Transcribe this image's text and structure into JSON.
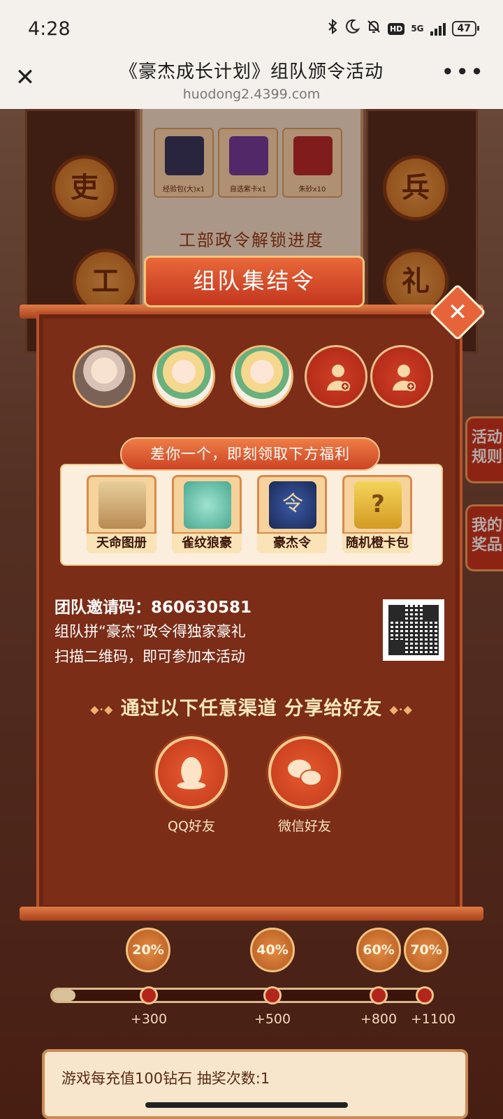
{
  "status_bar": {
    "time": "4:28",
    "network": "5G",
    "hd": "HD",
    "battery": "47"
  },
  "browser": {
    "title": "《豪杰成长计划》组队颁令活动",
    "url": "huodong2.4399.com",
    "close_glyph": "✕",
    "more_glyph": "•••"
  },
  "background": {
    "seals_left": [
      "吏",
      "工"
    ],
    "seals_right": [
      "兵",
      "礼"
    ],
    "rewards": [
      {
        "label": "经验包(大)x1",
        "color": "#2a3560"
      },
      {
        "label": "自选紫卡x1",
        "color": "#6a3aa0"
      },
      {
        "label": "朱砂x10",
        "color": "#b0282a"
      }
    ],
    "progress_title": "工部政令解锁进度",
    "side_buttons": [
      "活动规则",
      "我的奖品"
    ],
    "milestones": [
      {
        "percent": "20%",
        "reward": "+300"
      },
      {
        "percent": "40%",
        "reward": "+500"
      },
      {
        "percent": "60%",
        "reward": "+800"
      },
      {
        "percent": "70%",
        "reward": "+1100"
      }
    ],
    "progress_fill": 0.06,
    "bottom_card_text": "游戏每充值100钻石        抽奖次数:1"
  },
  "modal": {
    "title": "组队集结令",
    "close_glyph": "✕",
    "benefit_ribbon": "差你一个，即刻领取下方福利",
    "benefits": [
      {
        "label": "天命图册",
        "icon": "scroll-map-icon",
        "color": "#c7a06a"
      },
      {
        "label": "雀纹狼豪",
        "icon": "feather-brush-icon",
        "color": "#6ac6b0"
      },
      {
        "label": "豪杰令",
        "icon": "badge-icon",
        "color": "#2b3f7a"
      },
      {
        "label": "随机橙卡包",
        "icon": "mystery-card-icon",
        "color": "#e4b43a"
      }
    ],
    "mystery_glyph": "?",
    "badge_glyph": "令",
    "invite_label": "团队邀请码：",
    "invite_code": "860630581",
    "desc_line1": "组队拼“豪杰”政令得独家豪礼",
    "desc_line2": "扫描二维码，即可参加本活动",
    "share_title": "通过以下任意渠道 分享给好友",
    "share_deco_left": "◆·◆",
    "share_deco_right": "◆·◆",
    "share_qq": "QQ好友",
    "share_wechat": "微信好友"
  }
}
